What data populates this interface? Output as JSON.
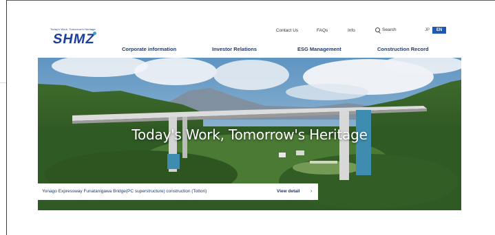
{
  "header": {
    "tagline": "Today's Work, Tomorrow's Heritage",
    "logo": "SHMZ",
    "utility": [
      "Contact Us",
      "FAQs",
      "Info"
    ],
    "search_label": "Search",
    "lang_jp": "JP",
    "lang_en": "EN"
  },
  "nav": [
    "Corporate information",
    "Investor Relations",
    "ESG Management",
    "Construction Record"
  ],
  "hero": {
    "title": "Today's Work, Tomorrow's Heritage",
    "caption": "Yonago Expressway Funatanigawa Bridge(PC superstructure) construction (Tottori)",
    "view_detail": "View detail"
  },
  "colors": {
    "brand": "#1d3f9e",
    "accent": "#1f57b5",
    "nav_text": "#1d3a6e"
  },
  "icons": [
    "search-icon",
    "chevron-right-icon"
  ]
}
